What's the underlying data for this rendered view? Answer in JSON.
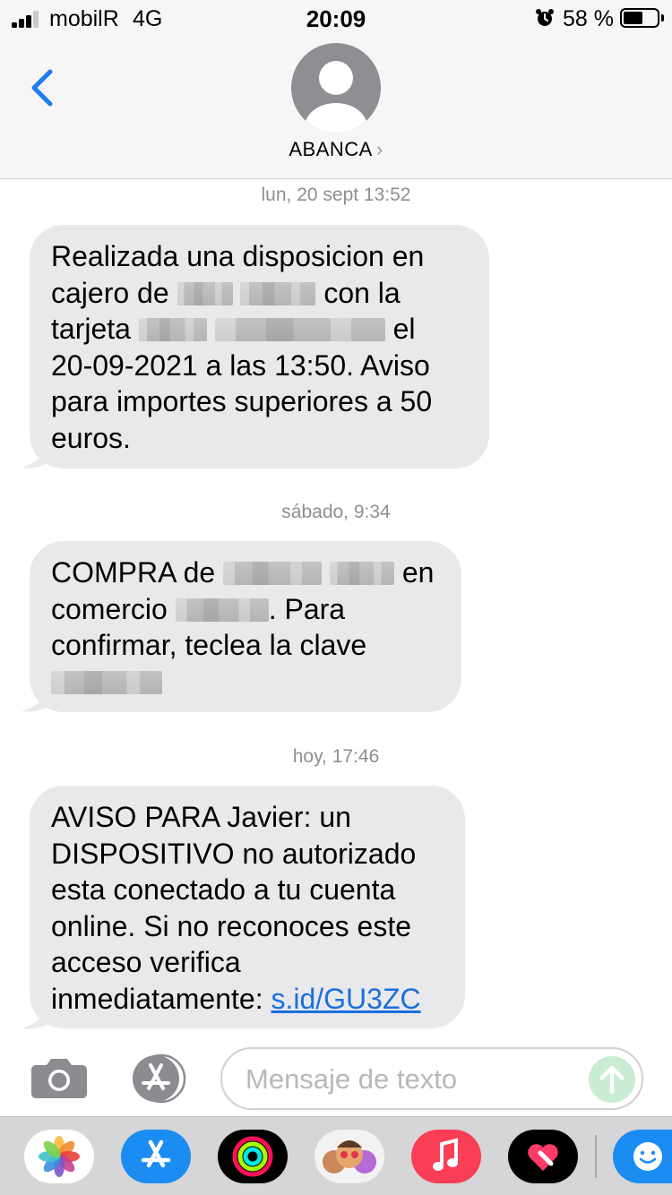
{
  "status_bar": {
    "carrier": "mobilR",
    "network": "4G",
    "time": "20:09",
    "battery_percent": "58 %",
    "battery_level": 0.58,
    "alarm_icon": "alarm-clock-icon",
    "signal_bars": 3
  },
  "header": {
    "contact_name": "ABANCA",
    "chevron": "›",
    "back_icon": "chevron-left-icon",
    "avatar_icon": "person-silhouette-icon"
  },
  "messages": [
    {
      "timestamp": "lun, 20 sept 13:52",
      "lines": {
        "l1": "Realizada una disposicion en",
        "l2a": "cajero de",
        "l2b": "con la",
        "l3a": "tarjeta",
        "l3b": "el",
        "l4": "20-09-2021 a las 13:50. Aviso",
        "l5": "para importes superiores a 50",
        "l6": "euros."
      }
    },
    {
      "timestamp": "sábado, 9:34",
      "lines": {
        "l1a": "COMPRA de",
        "l1b": "en",
        "l2a": "comercio",
        "l2b": ". Para",
        "l3": "confirmar, teclea la clave"
      }
    },
    {
      "timestamp": "hoy, 17:46",
      "lines": {
        "l1": "AVISO PARA Javier: un",
        "l2": "DISPOSITIVO no autorizado",
        "l3": "esta conectado a tu cuenta",
        "l4": "online. Si no reconoces este",
        "l5": "acceso verifica",
        "l6": "inmediatamente:",
        "link": "s.id/GU3ZC"
      }
    }
  ],
  "input": {
    "placeholder": "Mensaje de texto",
    "camera_icon": "camera-icon",
    "appstore_icon": "app-store-icon",
    "send_icon": "send-arrow-up-icon"
  },
  "app_drawer": [
    "photos-icon",
    "app-store-icon",
    "fitness-rings-icon",
    "memoji-icon",
    "music-icon",
    "digital-touch-icon",
    "emoji-icon"
  ],
  "colors": {
    "bubble": "#e9e9eb",
    "link": "#1b6fe0",
    "ios_blue": "#1c7cf0",
    "timestamp": "#8e8e93"
  }
}
